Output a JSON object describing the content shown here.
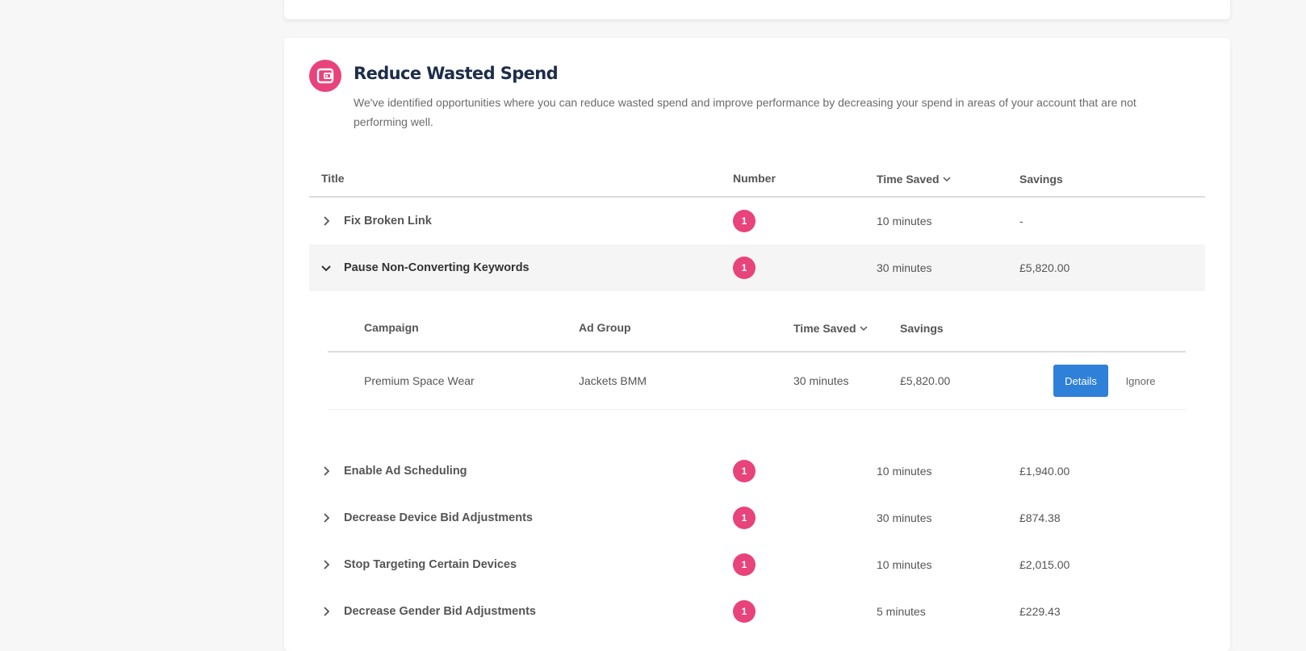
{
  "section": {
    "icon": "wallet-icon",
    "title": "Reduce Wasted Spend",
    "description": "We've identified opportunities where you can reduce wasted spend and improve performance by decreasing your spend in areas of your account that are not performing well."
  },
  "table": {
    "headers": {
      "title": "Title",
      "number": "Number",
      "time_saved": "Time Saved",
      "savings": "Savings"
    },
    "rows": [
      {
        "title": "Fix Broken Link",
        "number": "1",
        "time_saved": "10 minutes",
        "savings": "-",
        "expanded": false
      },
      {
        "title": "Pause Non-Converting Keywords",
        "number": "1",
        "time_saved": "30 minutes",
        "savings": "£5,820.00",
        "expanded": true
      },
      {
        "title": "Enable Ad Scheduling",
        "number": "1",
        "time_saved": "10 minutes",
        "savings": "£1,940.00",
        "expanded": false
      },
      {
        "title": "Decrease Device Bid Adjustments",
        "number": "1",
        "time_saved": "30 minutes",
        "savings": "£874.38",
        "expanded": false
      },
      {
        "title": "Stop Targeting Certain Devices",
        "number": "1",
        "time_saved": "10 minutes",
        "savings": "£2,015.00",
        "expanded": false
      },
      {
        "title": "Decrease Gender Bid Adjustments",
        "number": "1",
        "time_saved": "5 minutes",
        "savings": "£229.43",
        "expanded": false
      }
    ]
  },
  "subtable": {
    "headers": {
      "campaign": "Campaign",
      "ad_group": "Ad Group",
      "time_saved": "Time Saved",
      "savings": "Savings"
    },
    "rows": [
      {
        "campaign": "Premium Space Wear",
        "ad_group": "Jackets BMM",
        "time_saved": "30 minutes",
        "savings": "£5,820.00",
        "details_label": "Details",
        "ignore_label": "Ignore"
      }
    ]
  },
  "colors": {
    "accent_pink": "#e8437b",
    "button_blue": "#2f80d8",
    "title_navy": "#1d2d4a"
  }
}
